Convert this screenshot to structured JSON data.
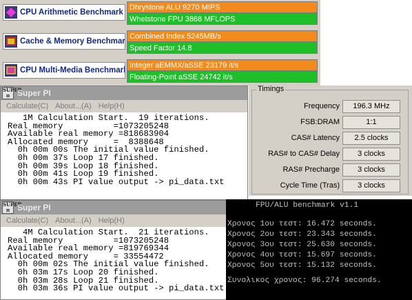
{
  "sandra": {
    "rows": [
      {
        "title": "CPU Arithmetic Benchmark",
        "top": "Dhrystone ALU 9270 MIPS",
        "bottom": "Whetstone FPU 3868 MFLOPS"
      },
      {
        "title": "Cache & Memory Benchmark",
        "top": "Combined Index 5245MB/s",
        "bottom": "Speed Factor 14.8"
      },
      {
        "title": "CPU Multi-Media Benchmark",
        "top": "Integer aEMMX/aSSE 23179 it/s",
        "bottom": "Floating-Point aSSE 24742 it/s"
      }
    ]
  },
  "superpi_1m": {
    "title": "Super PI",
    "menu": [
      "Calculate(C)",
      "About...(A)",
      "Help(H)"
    ],
    "lines": [
      "   1M Calculation Start.  19 iterations.",
      "Real memory          =1073205248",
      "Available real memory =818683904",
      "Allocated memory     =  8388648",
      "  0h 00m 00s The initial value finished.",
      "  0h 00m 37s Loop 17 finished.",
      "  0h 00m 39s Loop 18 finished.",
      "  0h 00m 41s Loop 19 finished.",
      "  0h 00m 43s PI value output -> pi_data.txt"
    ]
  },
  "superpi_4m": {
    "title": "Super PI",
    "menu": [
      "Calculate(C)",
      "About...(A)",
      "Help(H)"
    ],
    "lines": [
      "   4M Calculation Start.  21 iterations.",
      "Real memory          =1073205248",
      "Available real memory =819769344",
      "Allocated memory     = 33554472",
      "  0h 00m 02s The initial value finished.",
      "  0h 03m 17s Loop 20 finished.",
      "  0h 03m 28s Loop 21 finished.",
      "  0h 03m 36s PI value output -> pi_data.txt"
    ]
  },
  "timings": {
    "legend": "Timings",
    "rows": [
      {
        "label": "Frequency",
        "value": "196.3 MHz"
      },
      {
        "label": "FSB:DRAM",
        "value": "1:1"
      },
      {
        "label": "CAS# Latency",
        "value": "2.5 clocks"
      },
      {
        "label": "RAS# to CAS# Delay",
        "value": "3 clocks"
      },
      {
        "label": "RAS# Precharge",
        "value": "3 clocks"
      },
      {
        "label": "Cycle Time (Tras)",
        "value": "3 clocks"
      }
    ]
  },
  "fpu_alu": {
    "title": "FPU/ALU benchmark v1.1",
    "tests": [
      "Χρονος 1ου τεστ: 16.472 seconds.",
      "Χρονος 2ου τεστ: 23.343 seconds.",
      "Χρονος 3ου τεστ: 25.630 seconds.",
      "Χρονος 4ου τεστ: 15.697 seconds.",
      "Χρονος 5ου τεστ: 15.132 seconds."
    ],
    "total": "Συνολικος χρονος: 96.274 seconds."
  }
}
